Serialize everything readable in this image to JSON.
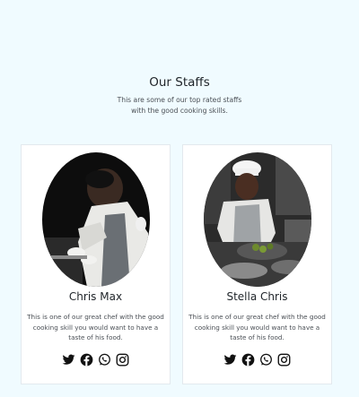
{
  "section": {
    "title": "Our Staffs",
    "subtitle_line1": "This are some of our top rated staffs",
    "subtitle_line2": "with the good cooking skills."
  },
  "staff": [
    {
      "name": "Chris Max",
      "description": "This is one of our great chef with the good cooking skill you would want to have a taste of his food.",
      "socials": [
        "twitter-icon",
        "facebook-icon",
        "whatsapp-icon",
        "instagram-icon"
      ]
    },
    {
      "name": "Stella Chris",
      "description": "This is one of our great chef with the good cooking skill you would want to have a taste of his food.",
      "socials": [
        "twitter-icon",
        "facebook-icon",
        "whatsapp-icon",
        "instagram-icon"
      ]
    }
  ],
  "colors": {
    "background": "#f0fbff",
    "card": "#ffffff",
    "text": "#1f2429",
    "muted": "#4a4f55"
  }
}
